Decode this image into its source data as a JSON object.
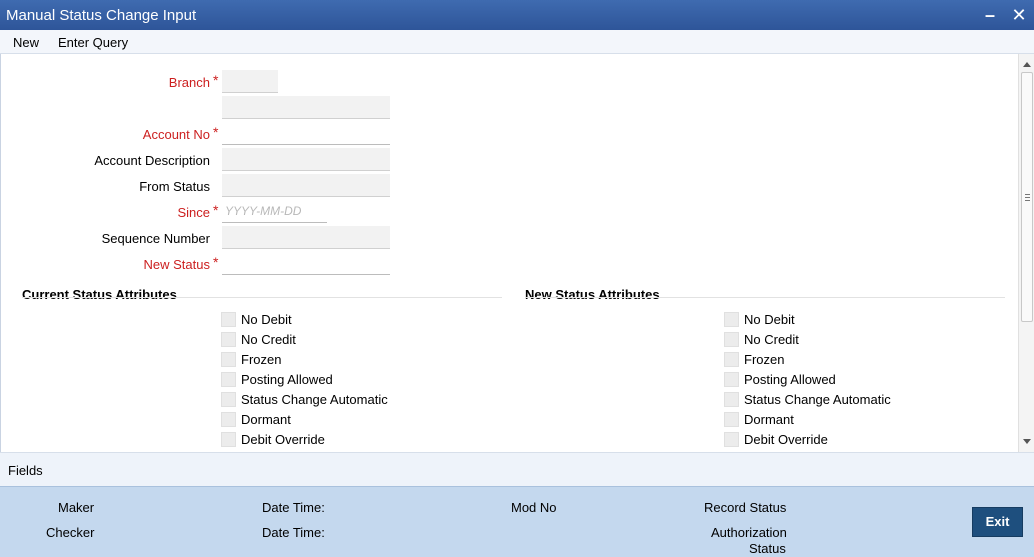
{
  "window": {
    "title": "Manual Status Change Input",
    "minimize_icon": "minimize-icon",
    "close_icon": "close-icon"
  },
  "menu": {
    "new": "New",
    "enter_query": "Enter Query"
  },
  "form": {
    "branch": {
      "label": "Branch",
      "value": "",
      "required": true
    },
    "branch_description": {
      "value": ""
    },
    "account_no": {
      "label": "Account No",
      "value": "",
      "required": true
    },
    "account_description": {
      "label": "Account Description",
      "value": ""
    },
    "from_status": {
      "label": "From Status",
      "value": ""
    },
    "since": {
      "label": "Since",
      "placeholder": "YYYY-MM-DD",
      "required": true
    },
    "sequence_number": {
      "label": "Sequence Number",
      "value": ""
    },
    "new_status": {
      "label": "New Status",
      "value": "",
      "required": true
    }
  },
  "current_status_attributes": {
    "title": "Current Status Attributes",
    "items": [
      "No Debit",
      "No Credit",
      "Frozen",
      "Posting Allowed",
      "Status Change Automatic",
      "Dormant",
      "Debit Override"
    ]
  },
  "new_status_attributes": {
    "title": "New Status Attributes",
    "items": [
      "No Debit",
      "No Credit",
      "Frozen",
      "Posting Allowed",
      "Status Change Automatic",
      "Dormant",
      "Debit Override"
    ]
  },
  "fields_link": "Fields",
  "footer": {
    "maker": "Maker",
    "checker": "Checker",
    "date_time_1": "Date Time:",
    "date_time_2": "Date Time:",
    "mod_no": "Mod No",
    "record_status": "Record Status",
    "authorization_status_1": "Authorization",
    "authorization_status_2": "Status",
    "exit": "Exit"
  },
  "colors": {
    "title_bar": "#2e5599",
    "required_label": "#cc1f1f",
    "footer_bg": "#c4d8ee",
    "exit_button": "#1e4f7e"
  }
}
